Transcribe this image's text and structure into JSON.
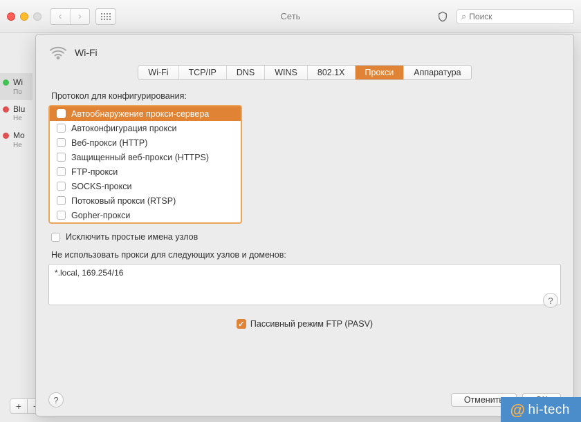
{
  "window": {
    "title": "Сеть"
  },
  "search": {
    "placeholder": "Поиск"
  },
  "sidebar": {
    "items": [
      {
        "name": "Wi",
        "sub": "По",
        "status": "green",
        "selected": true
      },
      {
        "name": "Blu",
        "sub": "Не",
        "status": "red",
        "selected": false
      },
      {
        "name": "Mo",
        "sub": "Не",
        "status": "red",
        "selected": false
      }
    ]
  },
  "sheet": {
    "title": "Wi-Fi",
    "tabs": [
      "Wi-Fi",
      "TCP/IP",
      "DNS",
      "WINS",
      "802.1X",
      "Прокси",
      "Аппаратура"
    ],
    "active_tab": "Прокси",
    "protocol_label": "Протокол для конфигурирования:",
    "protocols": [
      {
        "label": "Автообнаружение прокси-сервера",
        "selected": true
      },
      {
        "label": "Автоконфигурация прокси",
        "selected": false
      },
      {
        "label": "Веб-прокси (HTTP)",
        "selected": false
      },
      {
        "label": "Защищенный веб-прокси (HTTPS)",
        "selected": false
      },
      {
        "label": "FTP-прокси",
        "selected": false
      },
      {
        "label": "SOCKS-прокси",
        "selected": false
      },
      {
        "label": "Потоковый прокси (RTSP)",
        "selected": false
      },
      {
        "label": "Gopher-прокси",
        "selected": false
      }
    ],
    "exclude_simple": "Исключить простые имена узлов",
    "bypass_label": "Не использовать прокси для следующих узлов и доменов:",
    "bypass_value": "*.local, 169.254/16",
    "pasv_label": "Пассивный режим FTP (PASV)",
    "cancel": "Отменить",
    "ok": "OK"
  },
  "watermark": "hi-tech"
}
